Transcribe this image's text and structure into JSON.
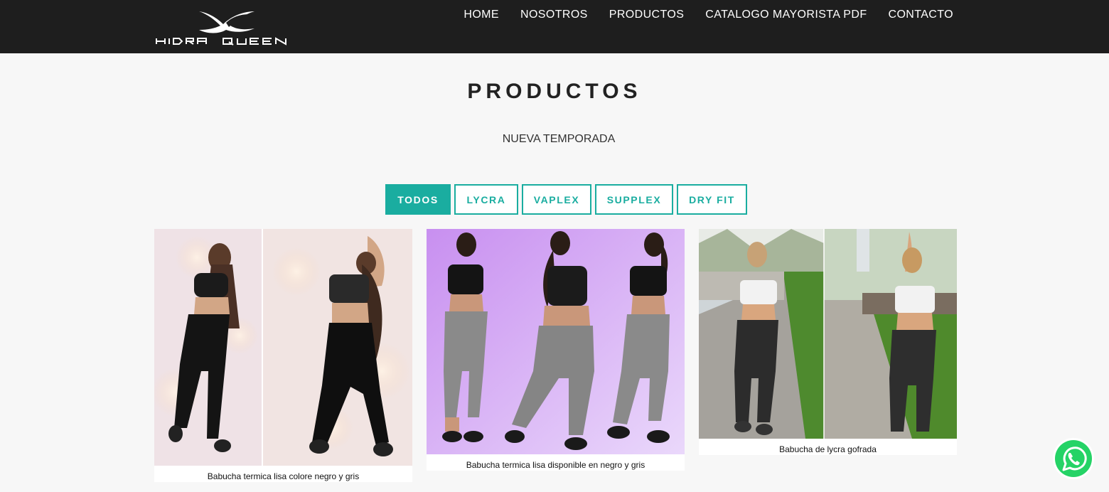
{
  "header": {
    "logo_text": "HIDRA QUEEN",
    "nav": [
      "HOME",
      "NOSOTROS",
      "PRODUCTOS",
      "CATALOGO MAYORISTA PDF",
      "CONTACTO"
    ]
  },
  "main": {
    "title": "PRODUCTOS",
    "subtitle": "NUEVA TEMPORADA",
    "filters": [
      {
        "label": "TODOS",
        "active": true
      },
      {
        "label": "LYCRA",
        "active": false
      },
      {
        "label": "VAPLEX",
        "active": false
      },
      {
        "label": "SUPPLEX",
        "active": false
      },
      {
        "label": "DRY FIT",
        "active": false
      }
    ],
    "products": [
      {
        "caption": "Babucha termica lisa colore negro y gris"
      },
      {
        "caption": "Babucha termica lisa disponible en negro y gris"
      },
      {
        "caption": "Babucha de lycra gofrada"
      }
    ]
  },
  "colors": {
    "header_bg": "#1e1e1e",
    "accent": "#1aada0",
    "page_bg": "#f7f7f7",
    "whatsapp": "#25d366"
  },
  "icons": {
    "logo": "hidra-queen-logo",
    "whatsapp": "whatsapp-icon"
  }
}
